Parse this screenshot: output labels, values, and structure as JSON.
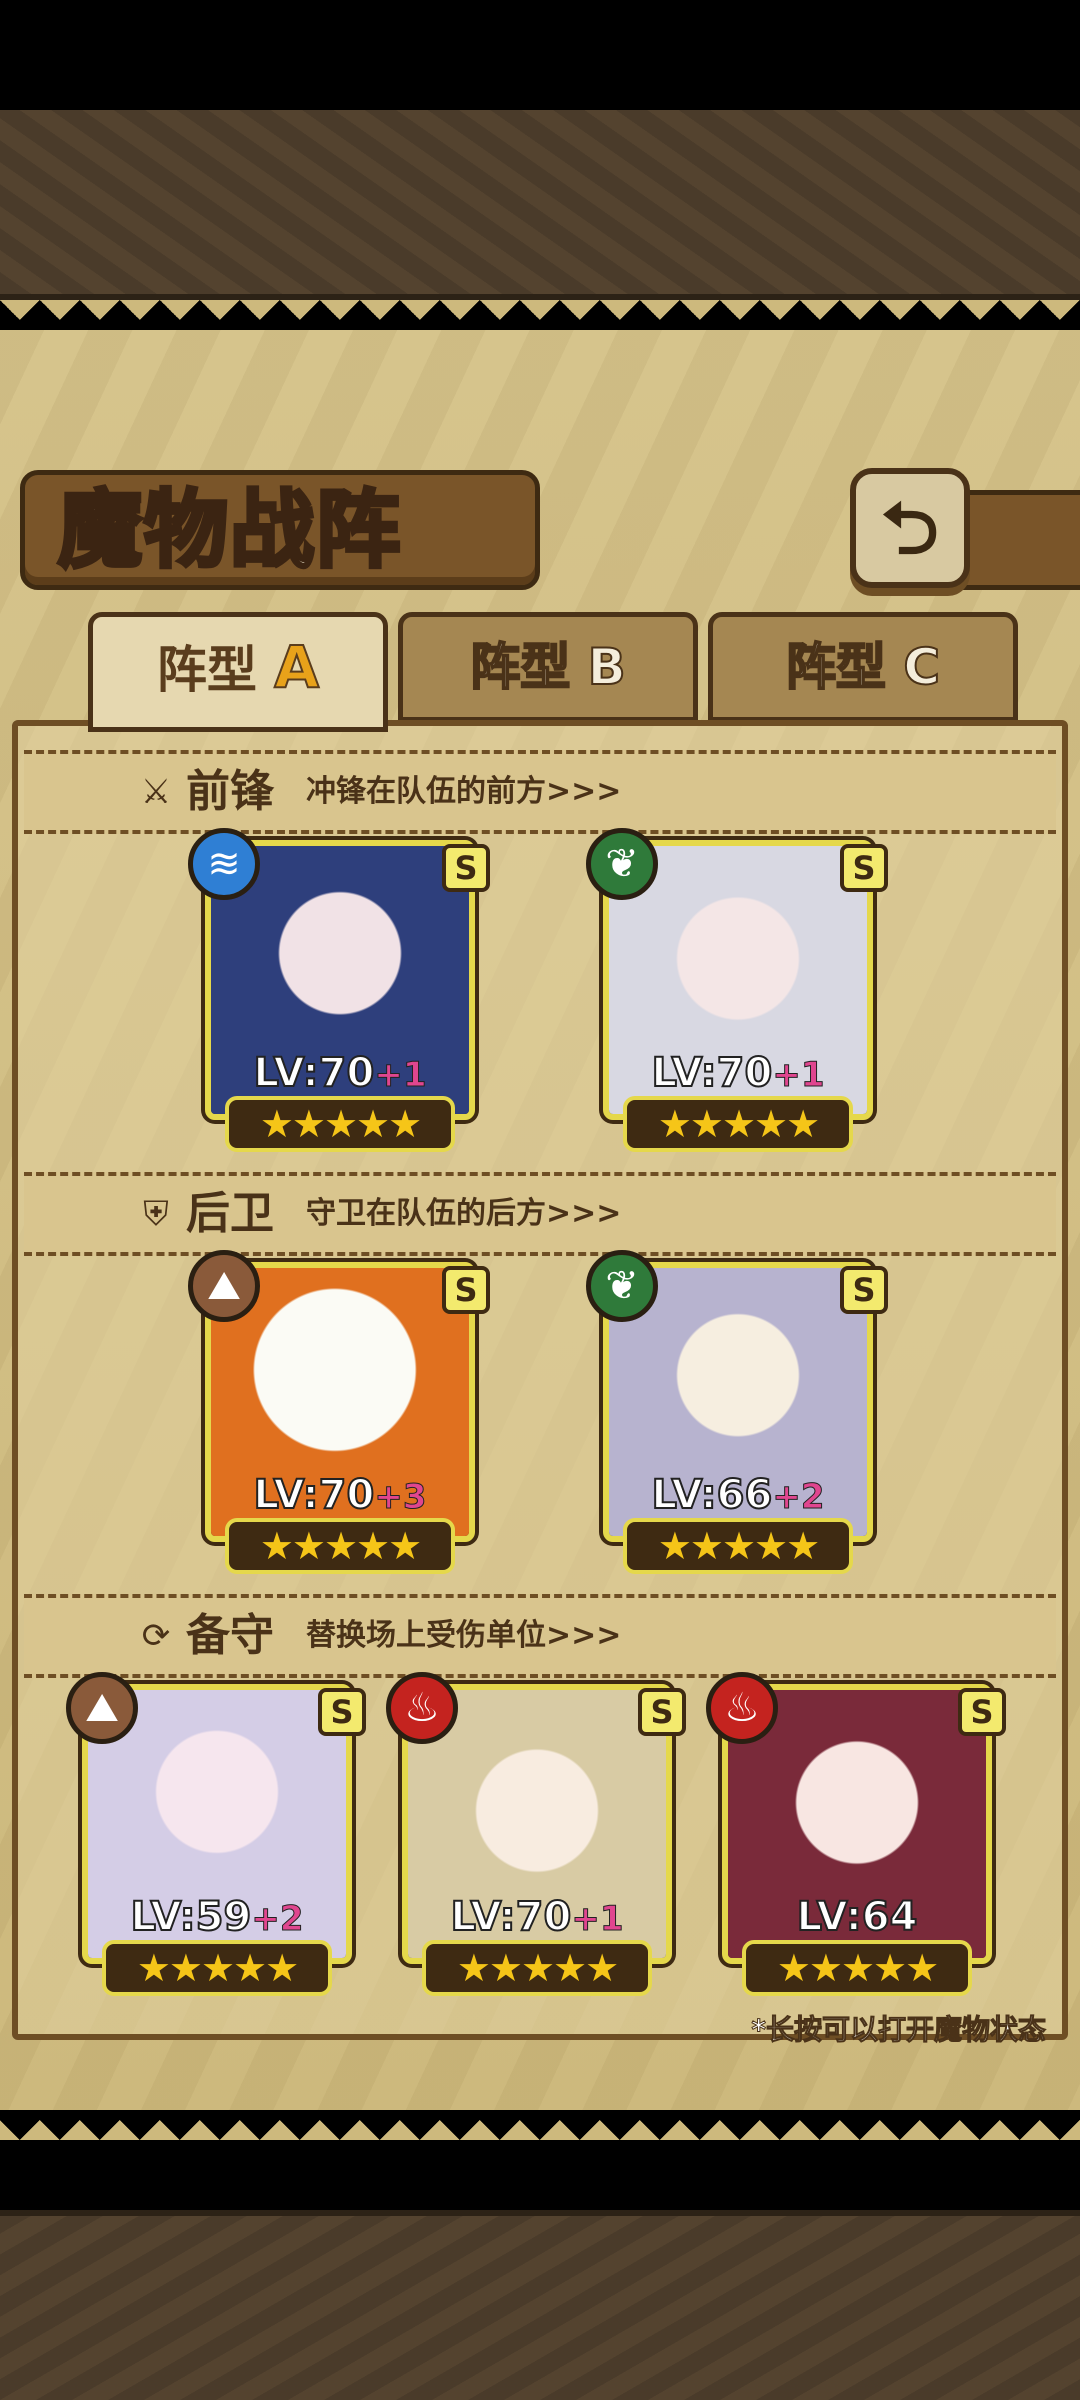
{
  "title": "魔物战阵",
  "back_icon": "return-arrow-icon",
  "tabs": [
    {
      "prefix": "阵型",
      "letter": "A",
      "active": true
    },
    {
      "prefix": "阵型",
      "letter": "B",
      "active": false
    },
    {
      "prefix": "阵型",
      "letter": "C",
      "active": false
    }
  ],
  "sections": {
    "front": {
      "title": "前锋",
      "desc": "冲锋在队伍的前方>>>",
      "icon": "sword-icon"
    },
    "rear": {
      "title": "后卫",
      "desc": "守卫在队伍的后方>>>",
      "icon": "shield-icon"
    },
    "reserve": {
      "title": "备守",
      "desc": "替换场上受伤单位>>>",
      "icon": "swap-icon"
    }
  },
  "units": {
    "front": [
      {
        "lv": "LV:70",
        "plus": "+1",
        "rank": "S",
        "element": "water",
        "stars": "★★★★★"
      },
      {
        "lv": "LV:70",
        "plus": "+1",
        "rank": "S",
        "element": "leaf",
        "stars": "★★★★★"
      }
    ],
    "rear": [
      {
        "lv": "LV:70",
        "plus": "+3",
        "rank": "S",
        "element": "earth",
        "stars": "★★★★★"
      },
      {
        "lv": "LV:66",
        "plus": "+2",
        "rank": "S",
        "element": "leaf",
        "stars": "★★★★★"
      }
    ],
    "reserve": [
      {
        "lv": "LV:59",
        "plus": "+2",
        "rank": "S",
        "element": "earth",
        "stars": "★★★★★"
      },
      {
        "lv": "LV:70",
        "plus": "+1",
        "rank": "S",
        "element": "fire",
        "stars": "★★★★★"
      },
      {
        "lv": "LV:64",
        "plus": "",
        "rank": "S",
        "element": "fire",
        "stars": "★★★★★"
      }
    ]
  },
  "hint": "*长按可以打开魔物状态",
  "colors": {
    "water": "#2f7fd4",
    "leaf": "#2f7a3a",
    "earth": "#8a5a3a",
    "fire": "#c4231f"
  }
}
